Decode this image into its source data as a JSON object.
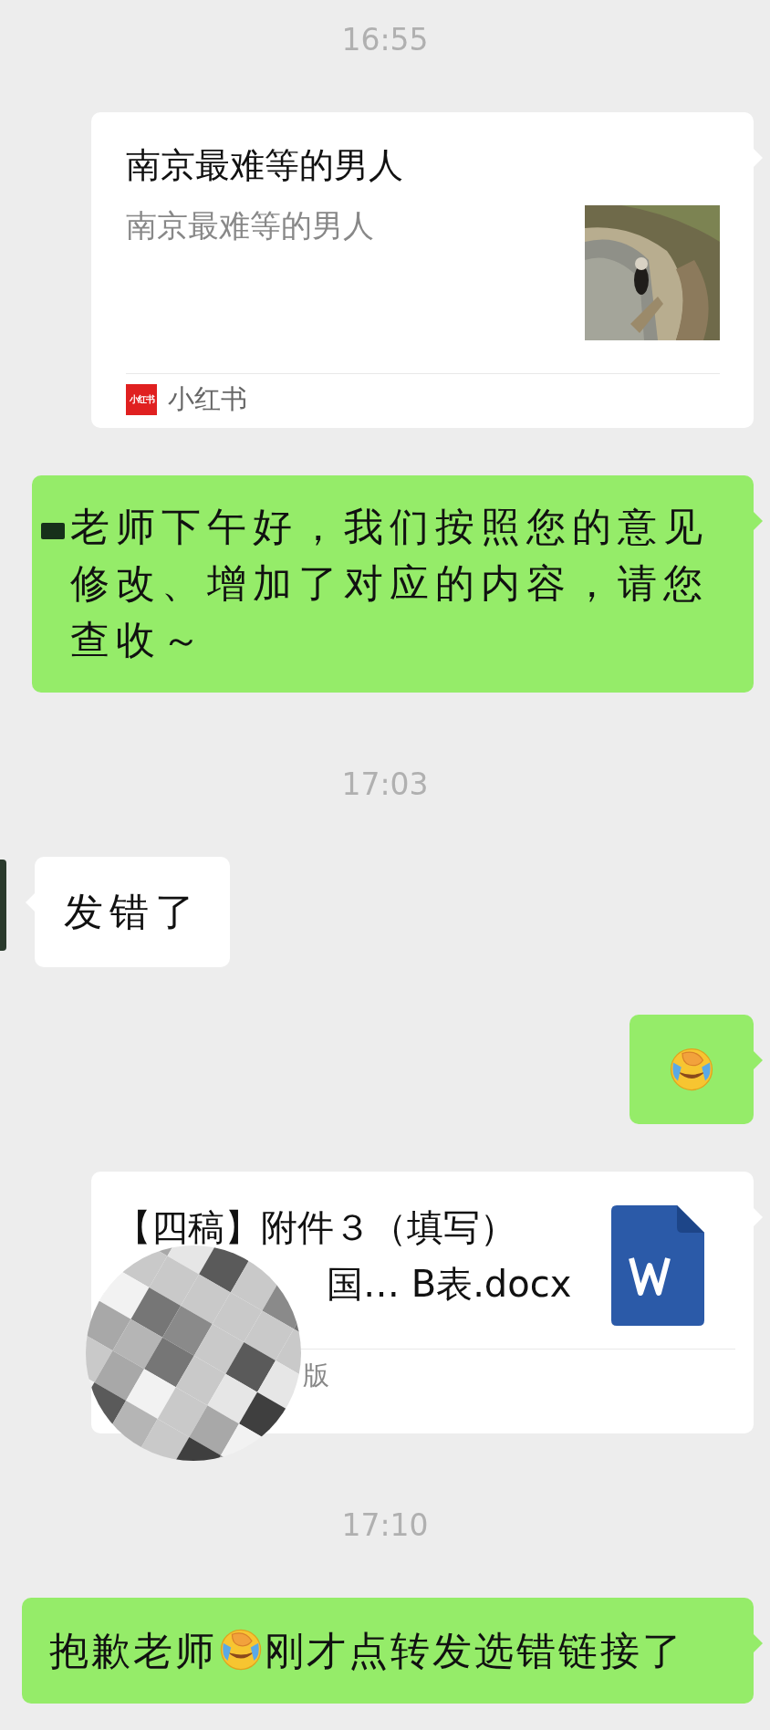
{
  "messages": [
    {
      "kind": "time",
      "text": "16:55"
    },
    {
      "kind": "link_card",
      "sent": true,
      "title": "南京最难等的男人",
      "description": "南京最难等的男人",
      "logo_text": "小红书",
      "source": "小红书"
    },
    {
      "kind": "text",
      "sent": true,
      "redacted_prefix": true,
      "text": "老师下午好，我们按照您的意见修改、增加了对应的内容，请您查收～"
    },
    {
      "kind": "time",
      "text": "17:03"
    },
    {
      "kind": "text",
      "sent": false,
      "avatar_edge": true,
      "text": "发错了"
    },
    {
      "kind": "emoji",
      "sent": true
    },
    {
      "kind": "file",
      "sent": true,
      "title": "【四稿】附件３（填写）",
      "title_line_2": "国… B表.docx",
      "source": "版",
      "redacted": true
    },
    {
      "kind": "time",
      "text": "17:10"
    },
    {
      "kind": "text_emoji",
      "sent": true,
      "before": "抱歉老师",
      "after": "刚才点转发选错链接了"
    }
  ]
}
